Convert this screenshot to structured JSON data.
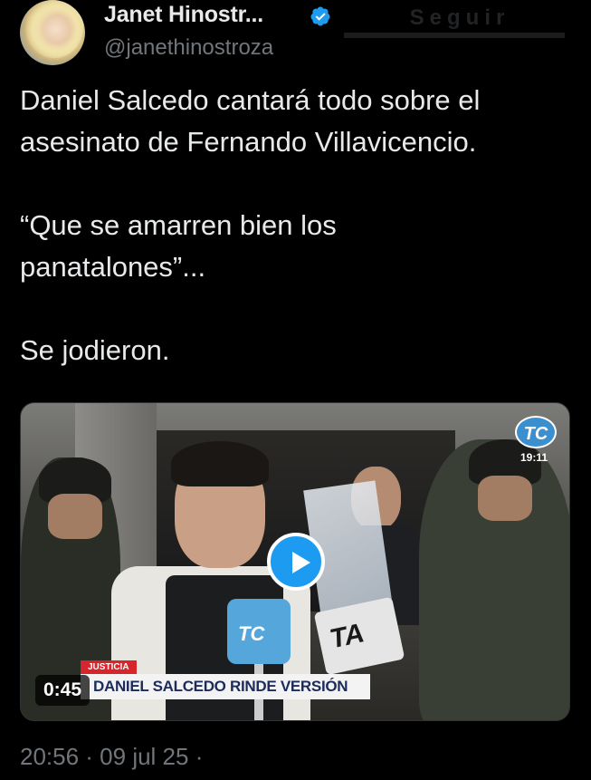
{
  "author": {
    "display_name": "Janet Hinostr...",
    "handle": "@janethinostroza",
    "verified": true,
    "follow_label": "Seguir"
  },
  "tweet": {
    "paragraphs": [
      "Daniel Salcedo cantará todo sobre el asesinato de Fernando Villavicencio.",
      "“Que se amarren bien los panatalones”...",
      "Se jodieron."
    ],
    "timestamp": "20:56 · 09 jul 25 ·"
  },
  "media": {
    "type": "video",
    "duration": "0:45",
    "channel_logo": "TC",
    "channel_clock": "19:11",
    "lower_third_tag": "JUSTICIA",
    "lower_third_headline": "DANIEL SALCEDO RINDE VERSIÓN",
    "mic_labels": [
      "TC",
      "TA"
    ]
  },
  "colors": {
    "background": "#000000",
    "text": "#e7e9ea",
    "muted": "#71767b",
    "accent": "#1d9bf0",
    "verified": "#1d9bf0"
  },
  "icons": {
    "verified": "verified-badge-icon",
    "play": "play-icon"
  }
}
